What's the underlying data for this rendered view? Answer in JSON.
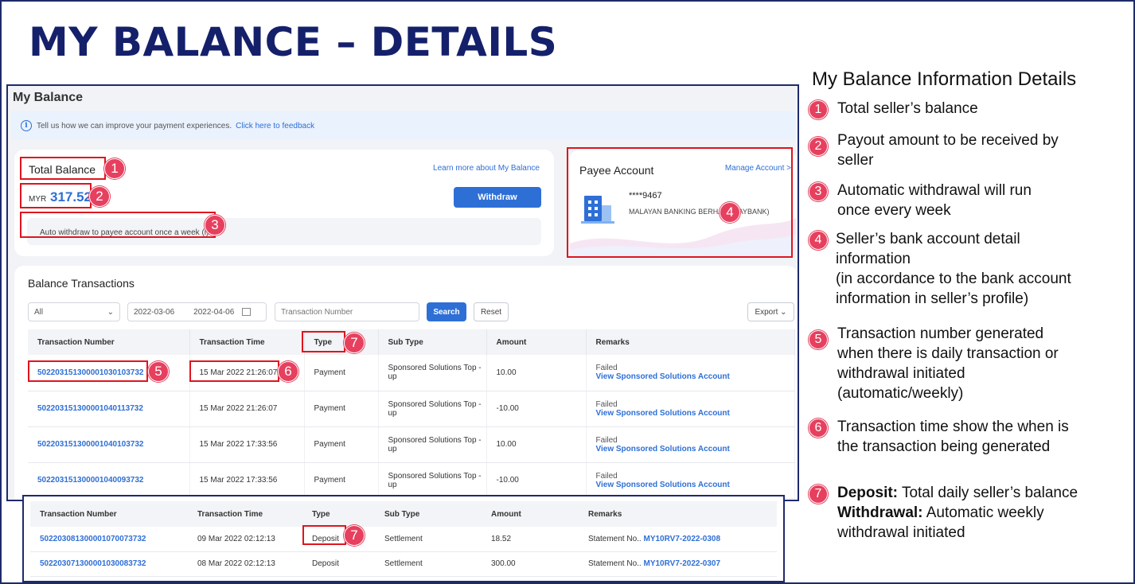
{
  "slide": {
    "title": "MY BALANCE – DETAILS"
  },
  "page": {
    "title": "My Balance",
    "feedback_text": "Tell us how we can improve your payment experiences.",
    "feedback_link": "Click here to feedback"
  },
  "balance_card": {
    "label": "Total Balance",
    "learn_more": "Learn more about My Balance",
    "currency": "MYR",
    "amount": "317.52",
    "withdraw_label": "Withdraw",
    "auto_withdraw_text": "Auto withdraw to payee account once a week (i)"
  },
  "payee": {
    "title": "Payee Account",
    "manage": "Manage Account >",
    "account_number": "****9467",
    "bank_name": "MALAYAN BANKING BERHAD (MAYBANK)"
  },
  "transactions": {
    "title": "Balance Transactions",
    "filter_select": "All",
    "date_from": "2022-03-06",
    "date_to": "2022-04-06",
    "search_placeholder": "Transaction Number",
    "search_label": "Search",
    "reset_label": "Reset",
    "export_label": "Export",
    "columns": [
      "Transaction Number",
      "Transaction Time",
      "Type",
      "Sub Type",
      "Amount",
      "Remarks"
    ],
    "rows": [
      {
        "number": "502203151300001030103732",
        "time": "15 Mar 2022 21:26:07",
        "type": "Payment",
        "sub": "Sponsored Solutions Top -up",
        "amount": "10.00",
        "status": "Failed",
        "link": "View Sponsored Solutions Account"
      },
      {
        "number": "502203151300001040113732",
        "time": "15 Mar 2022 21:26:07",
        "type": "Payment",
        "sub": "Sponsored Solutions Top -up",
        "amount": "-10.00",
        "status": "Failed",
        "link": "View Sponsored Solutions Account"
      },
      {
        "number": "502203151300001040103732",
        "time": "15 Mar 2022 17:33:56",
        "type": "Payment",
        "sub": "Sponsored Solutions Top -up",
        "amount": "10.00",
        "status": "Failed",
        "link": "View Sponsored Solutions Account"
      },
      {
        "number": "502203151300001040093732",
        "time": "15 Mar 2022 17:33:56",
        "type": "Payment",
        "sub": "Sponsored Solutions Top -up",
        "amount": "-10.00",
        "status": "Failed",
        "link": "View Sponsored Solutions Account"
      }
    ]
  },
  "deposits": {
    "columns": [
      "Transaction Number",
      "Transaction Time",
      "Type",
      "Sub Type",
      "Amount",
      "Remarks"
    ],
    "rows": [
      {
        "number": "502203081300001070073732",
        "time": "09 Mar 2022 02:12:13",
        "type": "Deposit",
        "sub": "Settlement",
        "amount": "18.52",
        "remark_prefix": "Statement No..",
        "statement": "MY10RV7-2022-0308"
      },
      {
        "number": "502203071300001030083732",
        "time": "08 Mar 2022 02:12:13",
        "type": "Deposit",
        "sub": "Settlement",
        "amount": "300.00",
        "remark_prefix": "Statement No..",
        "statement": "MY10RV7-2022-0307"
      }
    ]
  },
  "markers": [
    "1",
    "2",
    "3",
    "4",
    "5",
    "6",
    "7"
  ],
  "legend": {
    "title": "My Balance Information Details",
    "items": [
      {
        "num": "1",
        "text": "Total seller’s balance"
      },
      {
        "num": "2",
        "line1": "Payout amount to be received by",
        "line2": "seller"
      },
      {
        "num": "3",
        "line1": "Automatic withdrawal will run",
        "line2": "once every week"
      },
      {
        "num": "4",
        "line1": "Seller’s bank account detail",
        "line2": "information",
        "line3": "(in accordance to the bank account",
        "line4": "information in seller’s profile)"
      },
      {
        "num": "5",
        "line1": "Transaction number generated",
        "line2": "when there is daily transaction or",
        "line3": "withdrawal initiated",
        "line4": "(automatic/weekly)"
      },
      {
        "num": "6",
        "line1": "Transaction time show the when is",
        "line2": "the transaction being generated"
      },
      {
        "num": "7",
        "deposit_label": "Deposit:",
        "deposit_text": "Total daily seller’s balance",
        "withdrawal_label": "Withdrawal:",
        "withdrawal_text": "Automatic weekly",
        "line3": "withdrawal initiated"
      }
    ]
  },
  "colors": {
    "title_navy": "#15206b",
    "accent_blue": "#2e6fd6",
    "highlight_red": "#e0141e",
    "marker_pink": "#e6405e"
  }
}
